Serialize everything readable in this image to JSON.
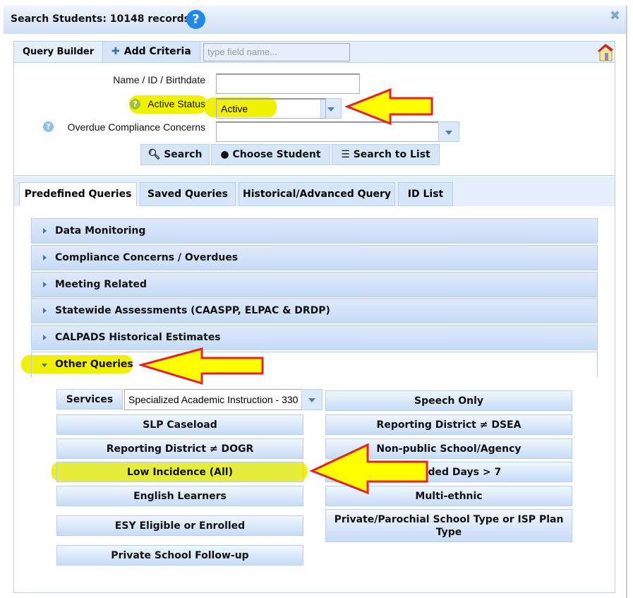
{
  "dialog": {
    "title": "Search Students: 10148 records",
    "help_icon": "question-circle-icon",
    "close_icon": "close-icon"
  },
  "toolbar": {
    "query_builder": "Query Builder",
    "add_criteria": "Add Criteria",
    "field_placeholder": "type field name...",
    "home_icon": "house-icon"
  },
  "form": {
    "name_label": "Name / ID / Birthdate",
    "name_value": "",
    "active_label": "Active Status",
    "active_value": "Active",
    "overdue_label": "Overdue Compliance Concerns",
    "overdue_value": ""
  },
  "actions": {
    "search": "Search",
    "choose": "Choose Student",
    "to_list": "Search to List"
  },
  "tabs": [
    "Predefined Queries",
    "Saved Queries",
    "Historical/Advanced Query",
    "ID List"
  ],
  "accordion": [
    "Data Monitoring",
    "Compliance Concerns / Overdues",
    "Meeting Related",
    "Statewide Assessments (CAASPP, ELPAC & DRDP)",
    "CALPADS Historical Estimates",
    "Other Queries"
  ],
  "other": {
    "services_label": "Services",
    "services_value": "Specialized Academic Instruction - 330",
    "left": [
      "SLP Caseload",
      "Reporting District ≠ DOGR",
      "Low Incidence (All)",
      "English Learners",
      "ESY Eligible or Enrolled",
      "Private School Follow-up"
    ],
    "right": [
      "Speech Only",
      "Reporting District ≠ DSEA",
      "Non-public School/Agency",
      "Extended Days > 7",
      "Multi-ethnic",
      "Private/Parochial School Type or ISP Plan Type"
    ]
  },
  "annotation_colors": {
    "arrow_fill": "#ffff00",
    "arrow_stroke": "#e8202a",
    "highlight": "#f0f000"
  }
}
